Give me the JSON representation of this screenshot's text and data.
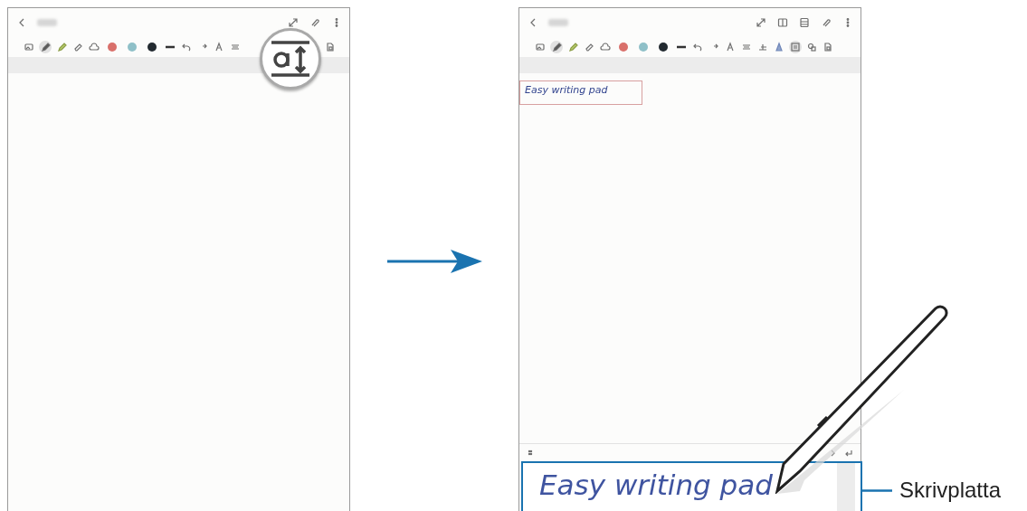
{
  "screens": [
    {
      "header_icons": [
        {
          "kind": "expand"
        },
        {
          "kind": "clip"
        },
        {
          "kind": "more"
        }
      ],
      "tools": [
        {
          "kind": "image",
          "selected": false
        },
        {
          "kind": "pen",
          "selected": true
        },
        {
          "kind": "highlighter",
          "selected": false
        },
        {
          "kind": "eraser",
          "selected": false
        },
        {
          "kind": "lasso",
          "selected": false
        },
        {
          "kind": "color",
          "color": "#d9706b"
        },
        {
          "kind": "color",
          "color": "#8fc0c8"
        },
        {
          "kind": "color",
          "color": "#222a30"
        },
        {
          "kind": "line",
          "selected": false
        },
        {
          "kind": "undo",
          "selected": false
        },
        {
          "kind": "redo",
          "selected": false
        },
        {
          "kind": "convert",
          "selected": false
        },
        {
          "kind": "align",
          "selected": false
        }
      ],
      "tools_end": [
        {
          "kind": "page",
          "selected": false
        }
      ],
      "magnifier": true
    },
    {
      "header_icons": [
        {
          "kind": "expand"
        },
        {
          "kind": "book"
        },
        {
          "kind": "layout"
        },
        {
          "kind": "clip"
        },
        {
          "kind": "more"
        }
      ],
      "tools": [
        {
          "kind": "image",
          "selected": false
        },
        {
          "kind": "pen",
          "selected": true
        },
        {
          "kind": "highlighter",
          "selected": false
        },
        {
          "kind": "eraser",
          "selected": false
        },
        {
          "kind": "lasso",
          "selected": false
        },
        {
          "kind": "color",
          "color": "#d9706b"
        },
        {
          "kind": "color",
          "color": "#8fc0c8"
        },
        {
          "kind": "color",
          "color": "#222a30"
        },
        {
          "kind": "line",
          "selected": false
        },
        {
          "kind": "undo",
          "selected": false
        },
        {
          "kind": "redo",
          "selected": false
        },
        {
          "kind": "convert",
          "selected": false
        },
        {
          "kind": "align",
          "selected": false
        },
        {
          "kind": "text",
          "selected": false
        },
        {
          "kind": "style",
          "selected": false
        },
        {
          "kind": "pad",
          "selected": true
        },
        {
          "kind": "shapes",
          "selected": false
        },
        {
          "kind": "page",
          "selected": false
        }
      ],
      "magnifier": false,
      "text_box": "Easy writing pad",
      "writing_pad": {
        "text": "Easy writing pad"
      }
    }
  ],
  "callout": {
    "label": "Skrivplatta"
  }
}
